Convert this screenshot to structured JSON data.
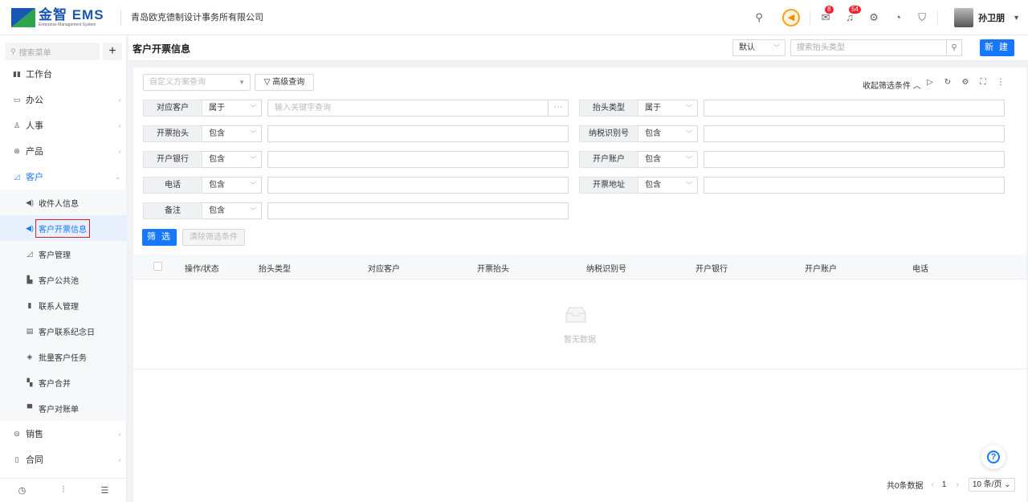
{
  "header": {
    "logo_text": "金智 EMS",
    "logo_sub": "Enterprise Management System",
    "company": "青岛欧克德制设计事务所有限公司",
    "mail_badge": "8",
    "bell_badge": "54",
    "user_name": "孙卫朋",
    "accent": "#1677ff"
  },
  "sidebar": {
    "search_placeholder": "搜索菜单",
    "add_label": "+",
    "items": [
      {
        "label": "工作台",
        "icon": "dashboard-icon",
        "arrow": ""
      },
      {
        "label": "办公",
        "icon": "office-icon",
        "arrow": "›"
      },
      {
        "label": "人事",
        "icon": "people-icon",
        "arrow": "›"
      },
      {
        "label": "产品",
        "icon": "product-icon",
        "arrow": "›"
      },
      {
        "label": "客户",
        "icon": "customer-icon",
        "arrow": "⌄"
      }
    ],
    "sub_items": [
      {
        "label": "收件人信息",
        "icon": "speaker-icon"
      },
      {
        "label": "客户开票信息",
        "icon": "speaker-icon"
      },
      {
        "label": "客户管理",
        "icon": "chart-icon"
      },
      {
        "label": "客户公共池",
        "icon": "bar-icon"
      },
      {
        "label": "联系人管理",
        "icon": "contacts-icon"
      },
      {
        "label": "客户联系纪念日",
        "icon": "calendar-icon"
      },
      {
        "label": "批量客户任务",
        "icon": "layers-icon"
      },
      {
        "label": "客户合并",
        "icon": "merge-icon"
      },
      {
        "label": "客户对账单",
        "icon": "bill-icon"
      }
    ],
    "bottom_items": [
      {
        "label": "销售",
        "icon": "sales-icon"
      },
      {
        "label": "合同",
        "icon": "contract-icon"
      }
    ]
  },
  "page": {
    "title": "客户开票信息",
    "view_select": "默认",
    "search_placeholder": "搜索抬头类型",
    "new_button": "新 建"
  },
  "filters": {
    "scheme_placeholder": "自定义方案查询",
    "advanced_label": "高级查询",
    "collapse_label": "收起筛选条件",
    "rows": [
      {
        "label": "对应客户",
        "op": "属于",
        "placeholder": "输入关键字查询"
      },
      {
        "label": "抬头类型",
        "op": "属于",
        "placeholder": ""
      },
      {
        "label": "开票抬头",
        "op": "包含",
        "placeholder": ""
      },
      {
        "label": "纳税识别号",
        "op": "包含",
        "placeholder": ""
      },
      {
        "label": "开户银行",
        "op": "包含",
        "placeholder": ""
      },
      {
        "label": "开户账户",
        "op": "包含",
        "placeholder": ""
      },
      {
        "label": "电话",
        "op": "包含",
        "placeholder": ""
      },
      {
        "label": "开票地址",
        "op": "包含",
        "placeholder": ""
      },
      {
        "label": "备注",
        "op": "包含",
        "placeholder": ""
      }
    ],
    "filter_button": "筛 选",
    "clear_button": "清除筛选条件"
  },
  "table": {
    "columns": [
      "操作/状态",
      "抬头类型",
      "对应客户",
      "开票抬头",
      "纳税识别号",
      "开户银行",
      "开户账户",
      "电话"
    ],
    "empty_text": "暂无数据"
  },
  "pager": {
    "total": "共0条数据",
    "prev": "‹",
    "page": "1",
    "next": "›",
    "page_size": "10 条/页 ⌄"
  },
  "help_label": "?"
}
